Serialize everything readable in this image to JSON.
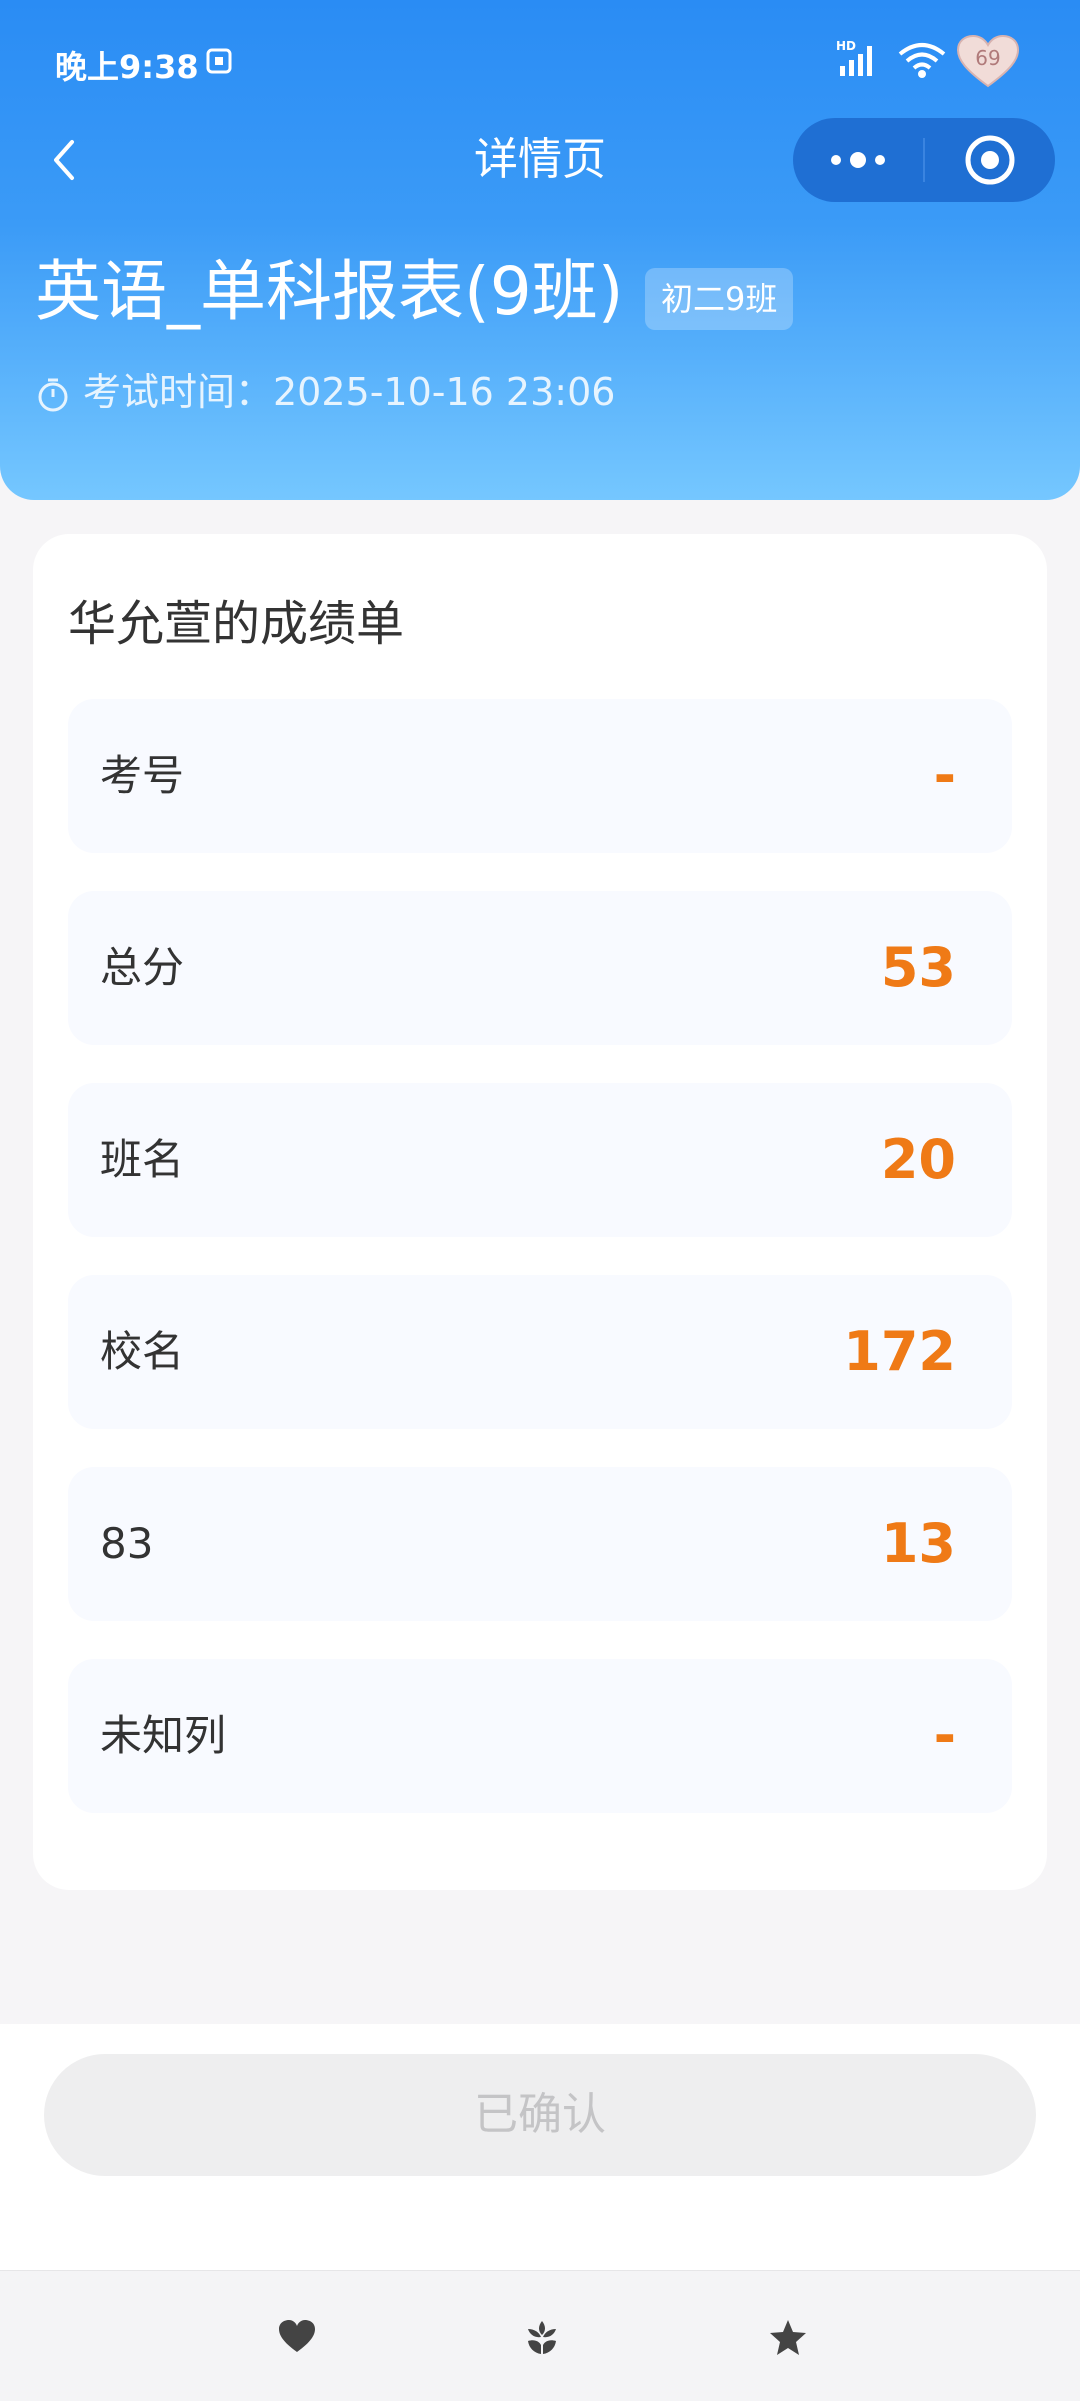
{
  "status_bar": {
    "time": "晚上9:38",
    "battery_badge": "69"
  },
  "nav": {
    "title": "详情页"
  },
  "report": {
    "title": "英语_单科报表(9班)",
    "class_tag": "初二9班",
    "exam_time": "考试时间：2025-10-16 23:06"
  },
  "card": {
    "title": "华允萱的成绩单",
    "rows": [
      {
        "label": "考号",
        "value": "-"
      },
      {
        "label": "总分",
        "value": "53"
      },
      {
        "label": "班名",
        "value": "20"
      },
      {
        "label": "校名",
        "value": "172"
      },
      {
        "label": "83",
        "value": "13"
      },
      {
        "label": "未知列",
        "value": "-"
      }
    ]
  },
  "confirm_button": "已确认",
  "colors": {
    "accent": "#2a8cf4",
    "value": "#ef7a16"
  },
  "tabbar_icons": [
    "heart-icon",
    "flower-icon",
    "star-icon"
  ]
}
